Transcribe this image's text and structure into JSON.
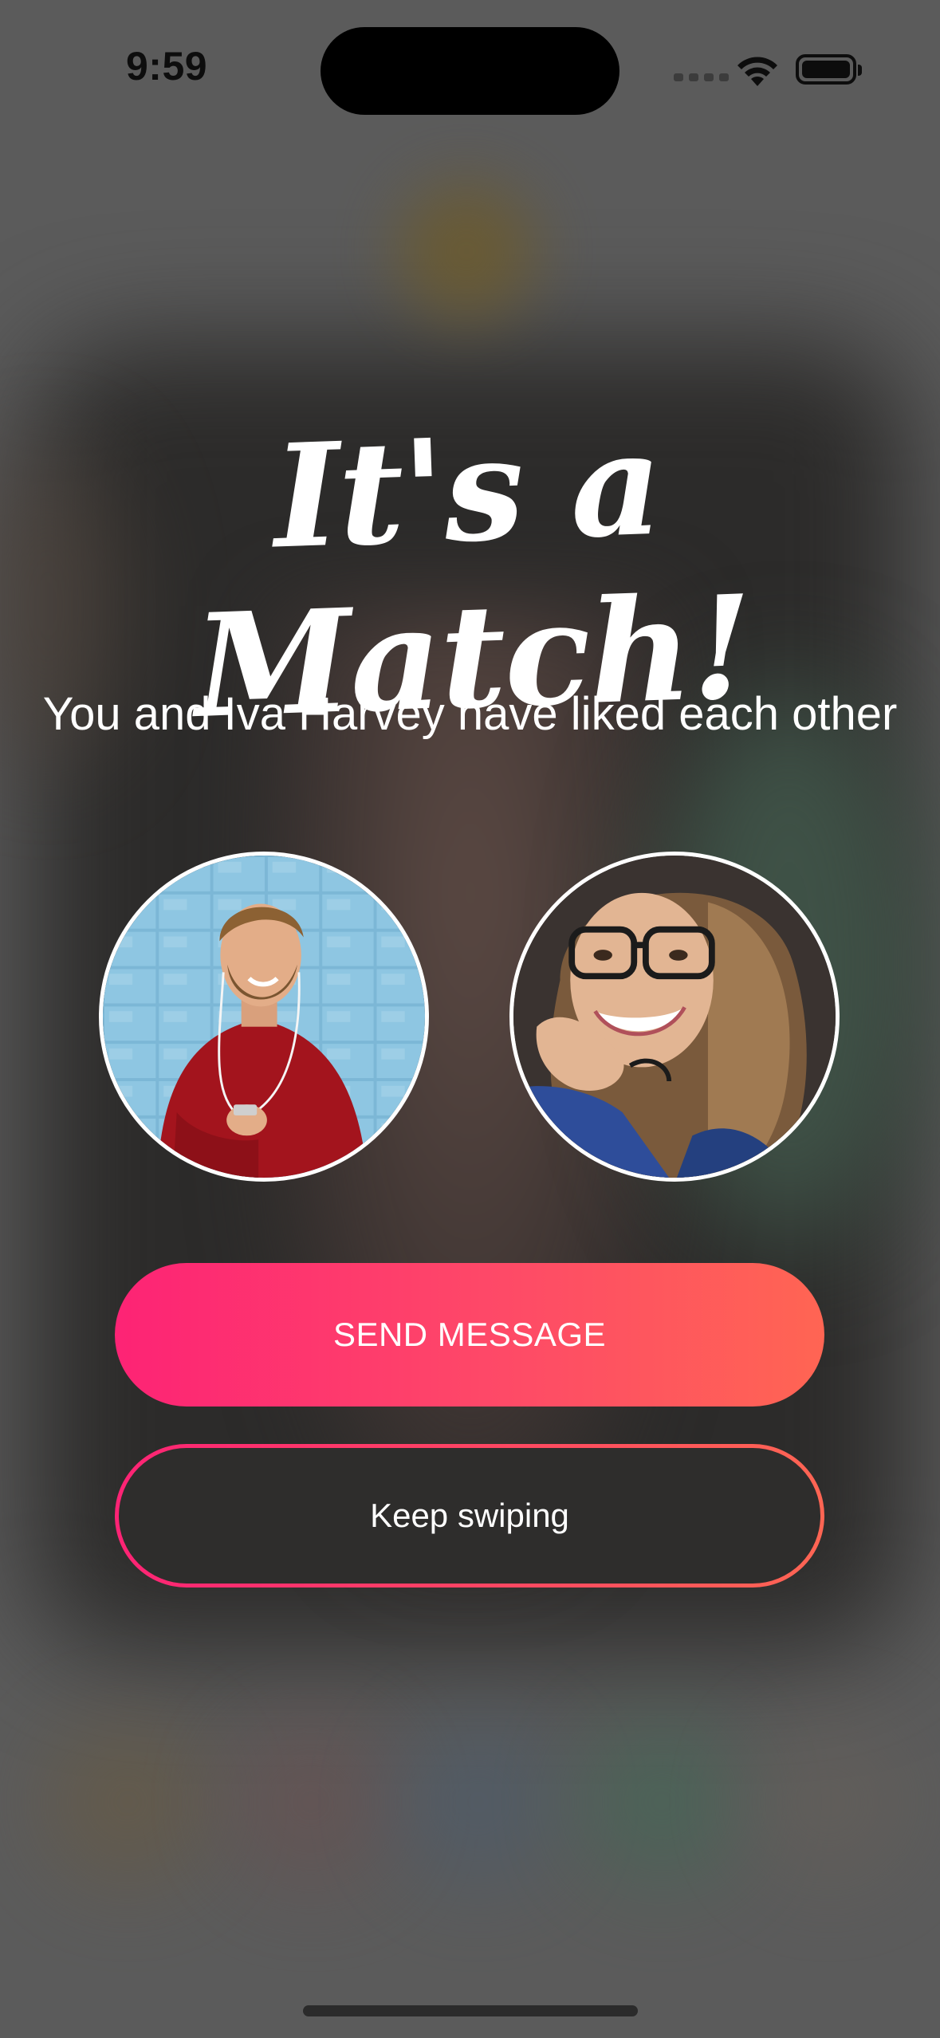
{
  "status_bar": {
    "time": "9:59"
  },
  "match": {
    "title": "It's a Match!",
    "subtitle": "You and Iva Harvey have liked each other"
  },
  "avatars": {
    "me": {
      "description_icon": "man-red-sweater-avatar"
    },
    "match": {
      "description_icon": "woman-glasses-avatar"
    }
  },
  "actions": {
    "send_message_label": "SEND MESSAGE",
    "keep_swiping_label": "Keep swiping"
  },
  "colors": {
    "accent_start": "#fd2375",
    "accent_end": "#ff6553"
  }
}
